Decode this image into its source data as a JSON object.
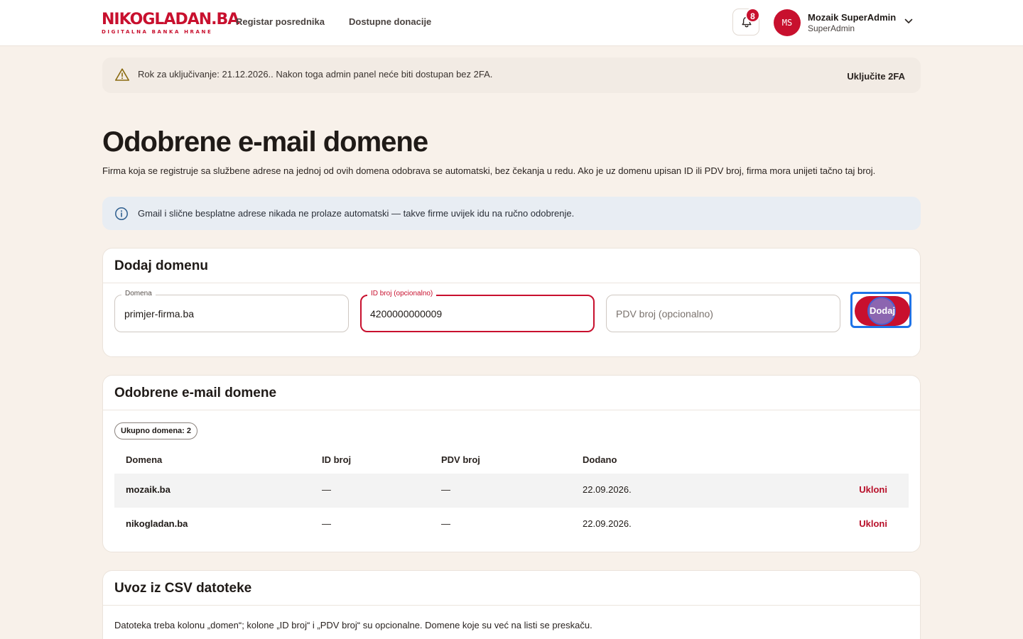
{
  "header": {
    "logo_main_a": "NIKOGLADAN",
    "logo_main_b": ".BA",
    "logo_sub": "DIGITALNA BANKA HRANE",
    "nav": [
      {
        "label": "Registar posrednika"
      },
      {
        "label": "Dostupne donacije"
      }
    ],
    "notifications_count": "8",
    "user": {
      "initials": "MS",
      "name": "Mozaik SuperAdmin",
      "role": "SuperAdmin"
    }
  },
  "alert_2fa": {
    "text": "Rok za uključivanje: 21.12.2026.. Nakon toga admin panel neće biti dostupan bez 2FA.",
    "action": "Uključite 2FA"
  },
  "page": {
    "title": "Odobrene e-mail domene",
    "description": "Firma koja se registruje sa službene adrese na jednoj od ovih domena odobrava se automatski, bez čekanja u redu. Ako je uz domenu upisan ID ili PDV broj, firma mora unijeti tačno taj broj."
  },
  "info": {
    "text": "Gmail i slične besplatne adrese nikada ne prolaze automatski — takve firme uvijek idu na ručno odobrenje."
  },
  "add_form": {
    "title": "Dodaj domenu",
    "domain": {
      "label": "Domena",
      "value": "primjer-firma.ba"
    },
    "id": {
      "label": "ID broj (opcionalno)",
      "value": "4200000000009"
    },
    "pdv": {
      "placeholder": "PDV broj (opcionalno)"
    },
    "submit_label": "Dodaj"
  },
  "list": {
    "title": "Odobrene e-mail domene",
    "count_label": "Ukupno domena: 2",
    "columns": {
      "domain": "Domena",
      "id": "ID broj",
      "pdv": "PDV broj",
      "added": "Dodano"
    },
    "rows": [
      {
        "domain": "mozaik.ba",
        "id": "—",
        "pdv": "—",
        "added": "22.09.2026.",
        "action": "Ukloni"
      },
      {
        "domain": "nikogladan.ba",
        "id": "—",
        "pdv": "—",
        "added": "22.09.2026.",
        "action": "Ukloni"
      }
    ]
  },
  "csv": {
    "title": "Uvoz iz CSV datoteke",
    "text": "Datoteka treba kolonu „domen“; kolone „ID broj“ i „PDV broj“ su opcionalne. Domene koje su već na listi se preskaču."
  },
  "colors": {
    "brand": "#c8102e",
    "background": "#f8f1ea",
    "focus_ring": "#1e73e8"
  }
}
